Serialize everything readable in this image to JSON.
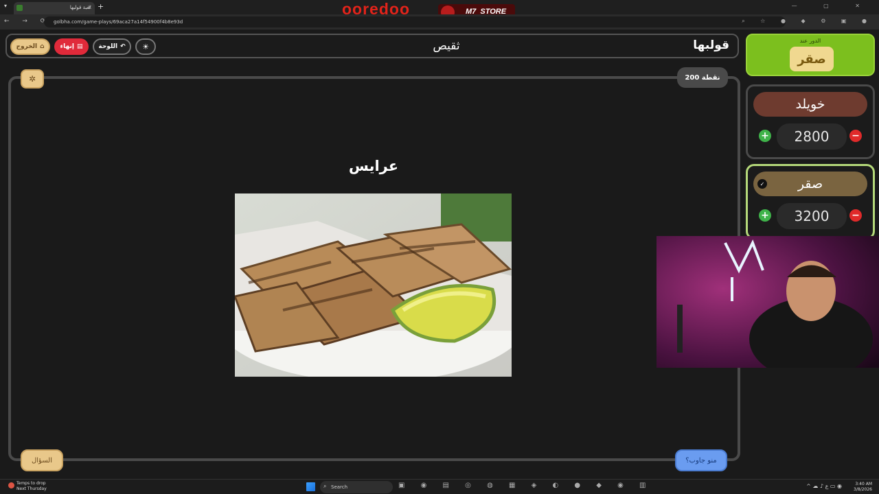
{
  "browser": {
    "tab_title": "لعبة قولبها",
    "url": "golbha.com/game-plays/69aca27a14f54900f4b8e93d",
    "new_tab": "+",
    "tab_close": "×"
  },
  "overlay": {
    "brand_left": "ooredoo",
    "brand_right": "M7_STORE"
  },
  "header": {
    "app_name": "قولبها",
    "category": "ثقيص",
    "exit_label": "الخروج",
    "end_label": "إنهاء",
    "board_label": "اللوحة"
  },
  "question": {
    "points": "200 نقطة",
    "answer": "عرايس",
    "question_button": "السؤال",
    "who_answered_button": "منو جاوب؟"
  },
  "turn": {
    "label": "الدور عند",
    "team": "صقر"
  },
  "teams": [
    {
      "name": "خويلد",
      "score": "2800",
      "active": false
    },
    {
      "name": "صقر",
      "score": "3200",
      "active": true
    }
  ],
  "taskbar": {
    "weather_line1": "Temps to drop",
    "weather_line2": "Next Thursday",
    "search_label": "Search",
    "time": "3:40 AM",
    "date": "3/8/2026"
  },
  "colors": {
    "accent_green": "#7cbf1e",
    "end_red": "#e02a3a",
    "gold": "#e9c88a",
    "who_blue": "#6a9cf0"
  }
}
